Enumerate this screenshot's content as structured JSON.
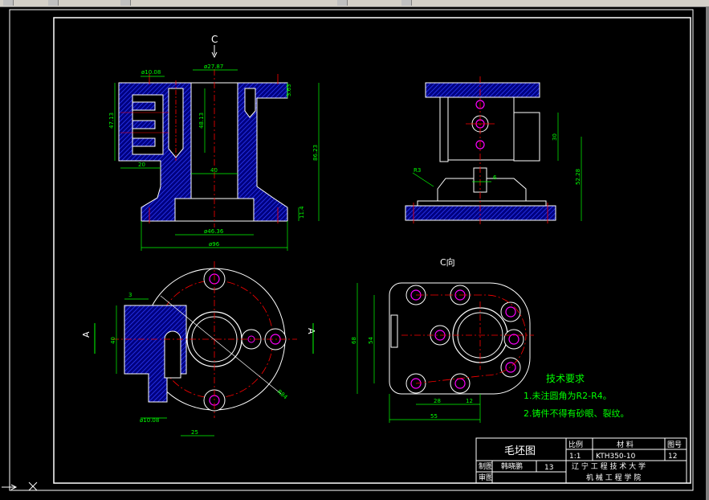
{
  "toolbar": {
    "label": "CAD toolbar"
  },
  "views": {
    "section_c_label": "C",
    "view_c_label": "C向",
    "a_label_left": "A",
    "a_label_right": "A"
  },
  "dims": {
    "d1008_top": "ø10.08",
    "d2787": "ø27.87",
    "d4713": "47.13",
    "d4813": "48.13",
    "d363": "3.63",
    "d8623": "86.23",
    "d20": "20",
    "d40": "40",
    "d4636": "ø46.36",
    "d96": "ø96",
    "d114": "11.4",
    "d30": "30",
    "d5228": "52.28",
    "dR3": "R3",
    "d6": "6",
    "d40_left": "40",
    "d3": "3",
    "d84": "R84",
    "d1008_bot": "ø10.08",
    "d25": "25",
    "d68": "68",
    "d54": "54",
    "d28": "28",
    "d12": "12",
    "d55": "55"
  },
  "notes": {
    "heading": "技术要求",
    "line1": "1.未注圆角为R2-R4。",
    "line2": "2.铸件不得有砂眼、裂纹。"
  },
  "title_block": {
    "drawing_name": "毛坯图",
    "scale_header": "比例",
    "material_header": "材  料",
    "sheet_header": "图号",
    "scale": "1:1",
    "material": "KTH350-10",
    "sheet_no": "12",
    "drawn_by_label": "制图",
    "drawn_by": "韩晓鹏",
    "number": "13",
    "checked_by_label": "审图",
    "school_line1": "辽 宁 工 程 技 术 大 学",
    "school_line2": "机 械 工 程 学 院"
  },
  "colors": {
    "dimension": "#00ff00",
    "outline": "#ffffff",
    "hatch": "#0000ff",
    "center": "#ff0000",
    "hole": "#ff00ff"
  }
}
